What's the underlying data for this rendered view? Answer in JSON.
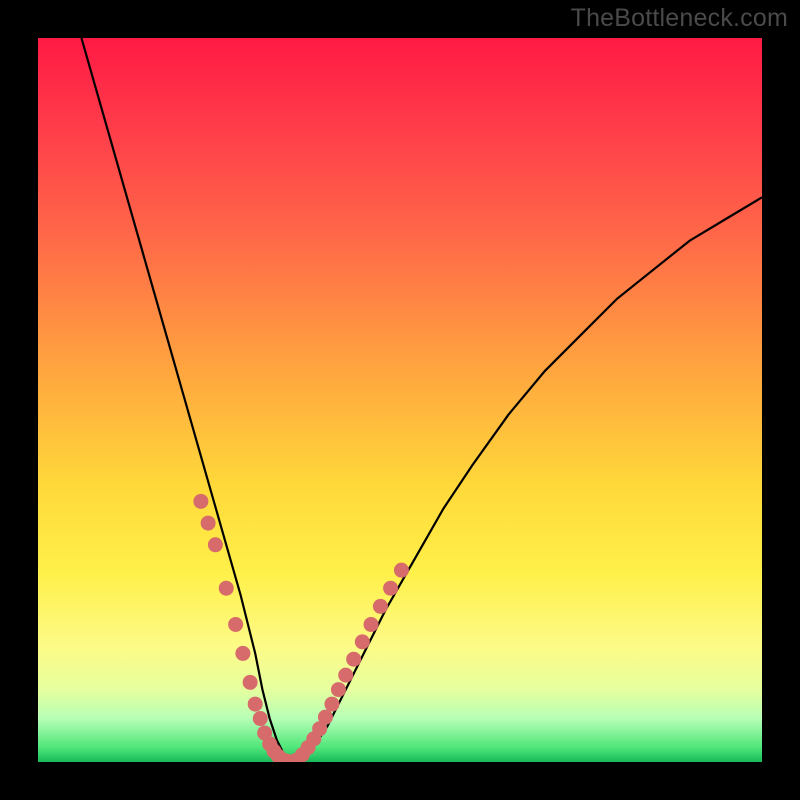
{
  "watermark": "TheBottleneck.com",
  "colors": {
    "background": "#000000",
    "curve_stroke": "#000000",
    "marker_fill": "#d76a6a",
    "gradient_stops": [
      "#ff1a44",
      "#ff3b4a",
      "#ff6a48",
      "#ffa63f",
      "#ffd93a",
      "#fff04a",
      "#fdfb87",
      "#e6ff9e",
      "#b6ffb6",
      "#4fe67a",
      "#17b95a"
    ]
  },
  "chart_data": {
    "type": "line",
    "title": "",
    "xlabel": "",
    "ylabel": "",
    "xlim": [
      0,
      100
    ],
    "ylim": [
      0,
      100
    ],
    "series": [
      {
        "name": "bottleneck-curve",
        "x": [
          6,
          8,
          10,
          12,
          14,
          16,
          18,
          20,
          22,
          24,
          26,
          28,
          30,
          31,
          32,
          33,
          34,
          35,
          36,
          38,
          40,
          42,
          45,
          48,
          52,
          56,
          60,
          65,
          70,
          75,
          80,
          85,
          90,
          95,
          100
        ],
        "y": [
          100,
          93,
          86,
          79,
          72,
          65,
          58,
          51,
          44,
          37,
          30,
          23,
          15,
          10,
          6,
          3,
          1,
          0,
          0.5,
          2,
          5,
          9,
          15,
          21,
          28,
          35,
          41,
          48,
          54,
          59,
          64,
          68,
          72,
          75,
          78
        ]
      }
    ],
    "markers_left": {
      "name": "highlight-left",
      "x": [
        22.5,
        23.5,
        24.5,
        26.0,
        27.3,
        28.3,
        29.3,
        30.0,
        30.7,
        31.3,
        32.0,
        32.6,
        33.2
      ],
      "y": [
        36,
        33,
        30,
        24,
        19,
        15,
        11,
        8,
        6,
        4,
        2.5,
        1.5,
        0.8
      ]
    },
    "markers_right": {
      "name": "highlight-right",
      "x": [
        36.5,
        37.3,
        38.1,
        38.9,
        39.7,
        40.6,
        41.5,
        42.5,
        43.6,
        44.8,
        46.0,
        47.3,
        48.7,
        50.2
      ],
      "y": [
        1,
        2,
        3.2,
        4.6,
        6.2,
        8,
        10,
        12,
        14.2,
        16.6,
        19,
        21.5,
        24,
        26.5
      ]
    },
    "markers_bottom": {
      "name": "highlight-bottom",
      "x": [
        33.8,
        34.4,
        35.0,
        35.6
      ],
      "y": [
        0.3,
        0.1,
        0.0,
        0.2
      ]
    }
  }
}
